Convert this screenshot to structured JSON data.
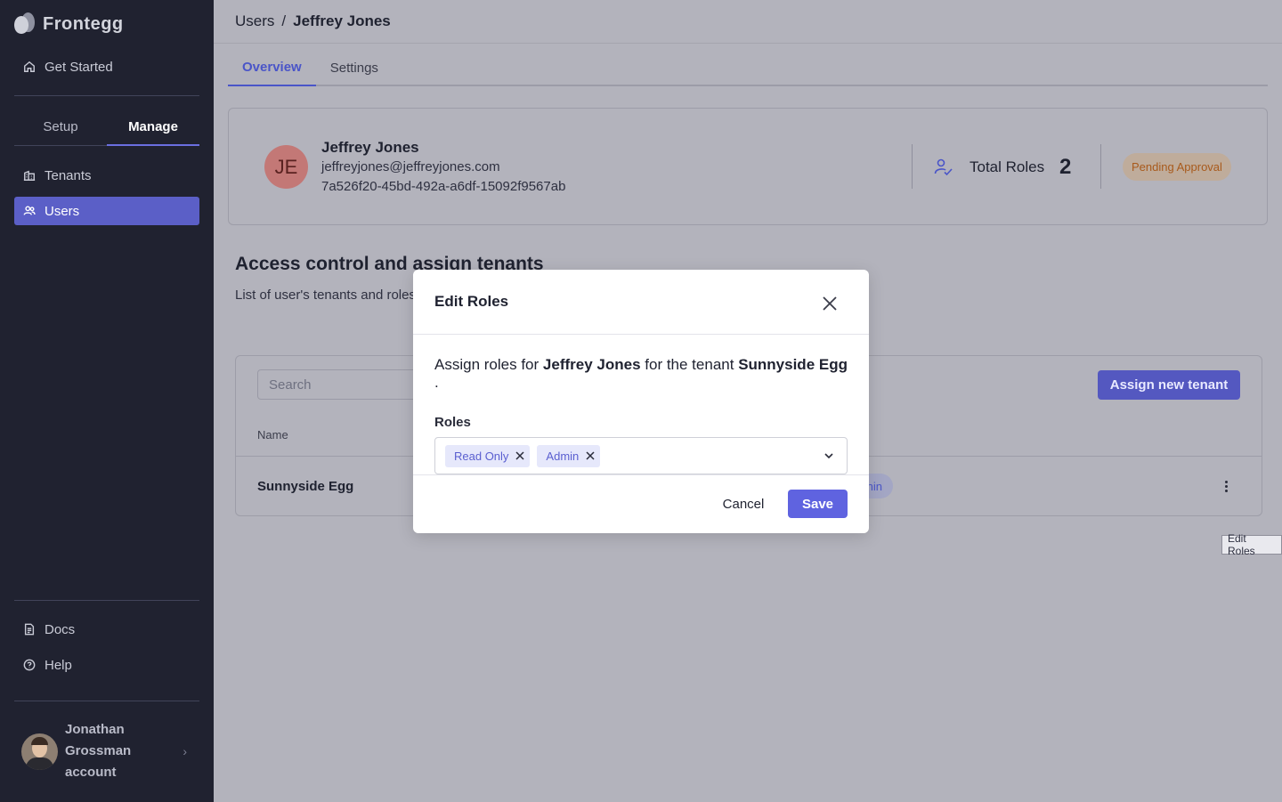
{
  "sidebar": {
    "brand": "Frontegg",
    "get_started": "Get Started",
    "segment_tabs": [
      "Setup",
      "Manage"
    ],
    "active_segment": "Manage",
    "nav_items": [
      {
        "label": "Tenants",
        "icon": "building-icon"
      },
      {
        "label": "Users",
        "icon": "users-icon",
        "active": true
      }
    ],
    "bottom_items": [
      {
        "label": "Docs",
        "icon": "document-icon"
      },
      {
        "label": "Help",
        "icon": "help-circle-icon"
      }
    ],
    "account": {
      "name": "Jonathan Grossman account"
    },
    "colors": {
      "background": "#202230",
      "active": "#5b5fc7"
    }
  },
  "header": {
    "breadcrumb": [
      "Users",
      "/",
      "Jeffrey Jones"
    ]
  },
  "tabs": [
    "Overview",
    "Settings"
  ],
  "active_tab": "Overview",
  "profile": {
    "initials": "JE",
    "name": "Jeffrey Jones",
    "email": "jeffreyjones@jeffreyjones.com",
    "id": "7a526f20-45bd-492a-a6df-15092f9567ab",
    "total_roles_label": "Total Roles",
    "total_roles": "2",
    "status": "Pending Approval"
  },
  "access": {
    "title": "Access control and assign tenants",
    "subtitle": "List of user's tenants and roles",
    "search_placeholder": "Search",
    "assign_button": "Assign new tenant",
    "column_name": "Name",
    "rows": [
      {
        "name": "Sunnyside Egg",
        "role_fragment": "nin"
      }
    ]
  },
  "tooltip": "Edit Roles",
  "modal": {
    "title": "Edit Roles",
    "assign_prefix": "Assign roles for",
    "user": "Jeffrey Jones",
    "assign_middle": "for the tenant",
    "tenant": "Sunnyside Egg",
    "assign_suffix": ".",
    "roles_label": "Roles",
    "selected_roles": [
      "Read Only",
      "Admin"
    ],
    "cancel": "Cancel",
    "save": "Save",
    "colors": {
      "primary": "#5f63e0",
      "chip_bg": "#e6e8fb",
      "chip_text": "#5a5fd0"
    }
  }
}
